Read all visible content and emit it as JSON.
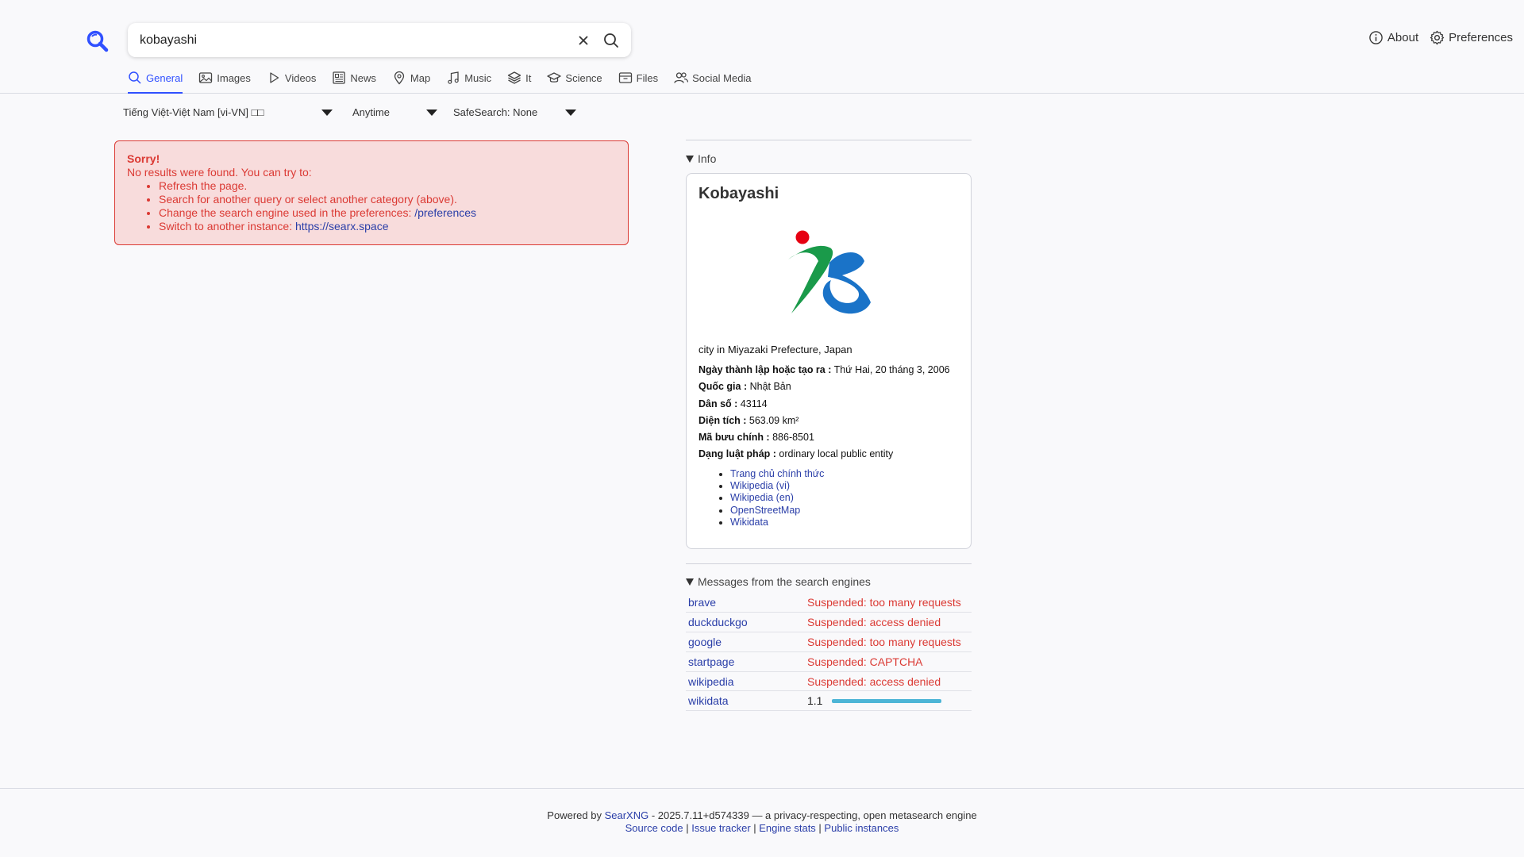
{
  "search": {
    "query": "kobayashi"
  },
  "top_links": {
    "about": "About",
    "preferences": "Preferences"
  },
  "tabs": [
    {
      "label": "General",
      "icon": "search-icon",
      "active": true
    },
    {
      "label": "Images",
      "icon": "image-icon"
    },
    {
      "label": "Videos",
      "icon": "play-icon"
    },
    {
      "label": "News",
      "icon": "newspaper-icon"
    },
    {
      "label": "Map",
      "icon": "map-pin-icon"
    },
    {
      "label": "Music",
      "icon": "music-note-icon"
    },
    {
      "label": "It",
      "icon": "layers-icon"
    },
    {
      "label": "Science",
      "icon": "graduation-cap-icon"
    },
    {
      "label": "Files",
      "icon": "archive-icon"
    },
    {
      "label": "Social Media",
      "icon": "people-icon"
    }
  ],
  "filters": {
    "language": "Tiếng Việt-Việt Nam [vi-VN] □□",
    "time": "Anytime",
    "safesearch": "SafeSearch: None"
  },
  "error": {
    "title": "Sorry!",
    "message": "No results were found. You can try to:",
    "item1": "Refresh the page.",
    "item2": "Search for another query or select another category (above).",
    "item3_text": "Change the search engine used in the preferences: ",
    "item3_link": "/preferences",
    "item4_text": "Switch to another instance: ",
    "item4_link": "https://searx.space"
  },
  "infobox": {
    "section_label": "Info",
    "title": "Kobayashi",
    "description": "city in Miyazaki Prefecture, Japan",
    "attributes": [
      {
        "label": "Ngày thành lập hoặc tạo ra :",
        "value": " Thứ Hai, 20 tháng 3, 2006"
      },
      {
        "label": "Quốc gia :",
        "value": " Nhật Bản"
      },
      {
        "label": "Dân số :",
        "value": " 43114"
      },
      {
        "label": "Diện tích :",
        "value": " 563.09 km²"
      },
      {
        "label": "Mã bưu chính :",
        "value": " 886-8501"
      },
      {
        "label": "Dạng luật pháp :",
        "value": " ordinary local public entity"
      }
    ],
    "links": [
      "Trang chủ chính thức",
      "Wikipedia (vi)",
      "Wikipedia (en)",
      "OpenStreetMap",
      "Wikidata"
    ]
  },
  "messages": {
    "section_label": "Messages from the search engines",
    "engines": [
      {
        "name": "brave",
        "status": "Suspended: too many requests"
      },
      {
        "name": "duckduckgo",
        "status": "Suspended: access denied"
      },
      {
        "name": "google",
        "status": "Suspended: too many requests"
      },
      {
        "name": "startpage",
        "status": "Suspended: CAPTCHA"
      },
      {
        "name": "wikipedia",
        "status": "Suspended: access denied"
      },
      {
        "name": "wikidata",
        "time": "1.1"
      }
    ]
  },
  "footer": {
    "powered_by": "Powered by ",
    "searxng": "SearXNG",
    "version": " - 2025.7.11+d574339 — a privacy-respecting, open metasearch engine",
    "source_code": "Source code",
    "issue_tracker": "Issue tracker",
    "engine_stats": "Engine stats",
    "public_instances": "Public instances",
    "separator": " | "
  },
  "colors": {
    "accent": "#3050ff",
    "error": "#db3a34",
    "link": "#2a3ea8",
    "bar": "#4db5d6"
  }
}
